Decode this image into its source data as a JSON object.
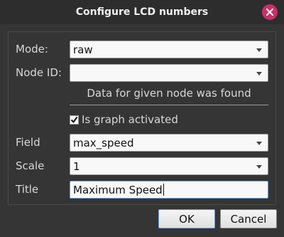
{
  "window": {
    "title": "Configure LCD numbers"
  },
  "form": {
    "mode_label": "Mode:",
    "mode_value": "raw",
    "node_label": "Node ID:",
    "node_value": "",
    "info_text": "Data for given node was found",
    "graph_label": "Is graph activated",
    "graph_checked": true,
    "field_label": "Field",
    "field_value": "max_speed",
    "scale_label": "Scale",
    "scale_value": "1",
    "title_label": "Title",
    "title_value": "Maximum Speed"
  },
  "buttons": {
    "ok": "OK",
    "cancel": "Cancel"
  },
  "colors": {
    "close_accent": "#c8306a",
    "focus_border": "#6ea0d8"
  },
  "icons": {
    "close": "close-icon",
    "dropdown": "chevron-down-icon",
    "check": "check-icon"
  }
}
